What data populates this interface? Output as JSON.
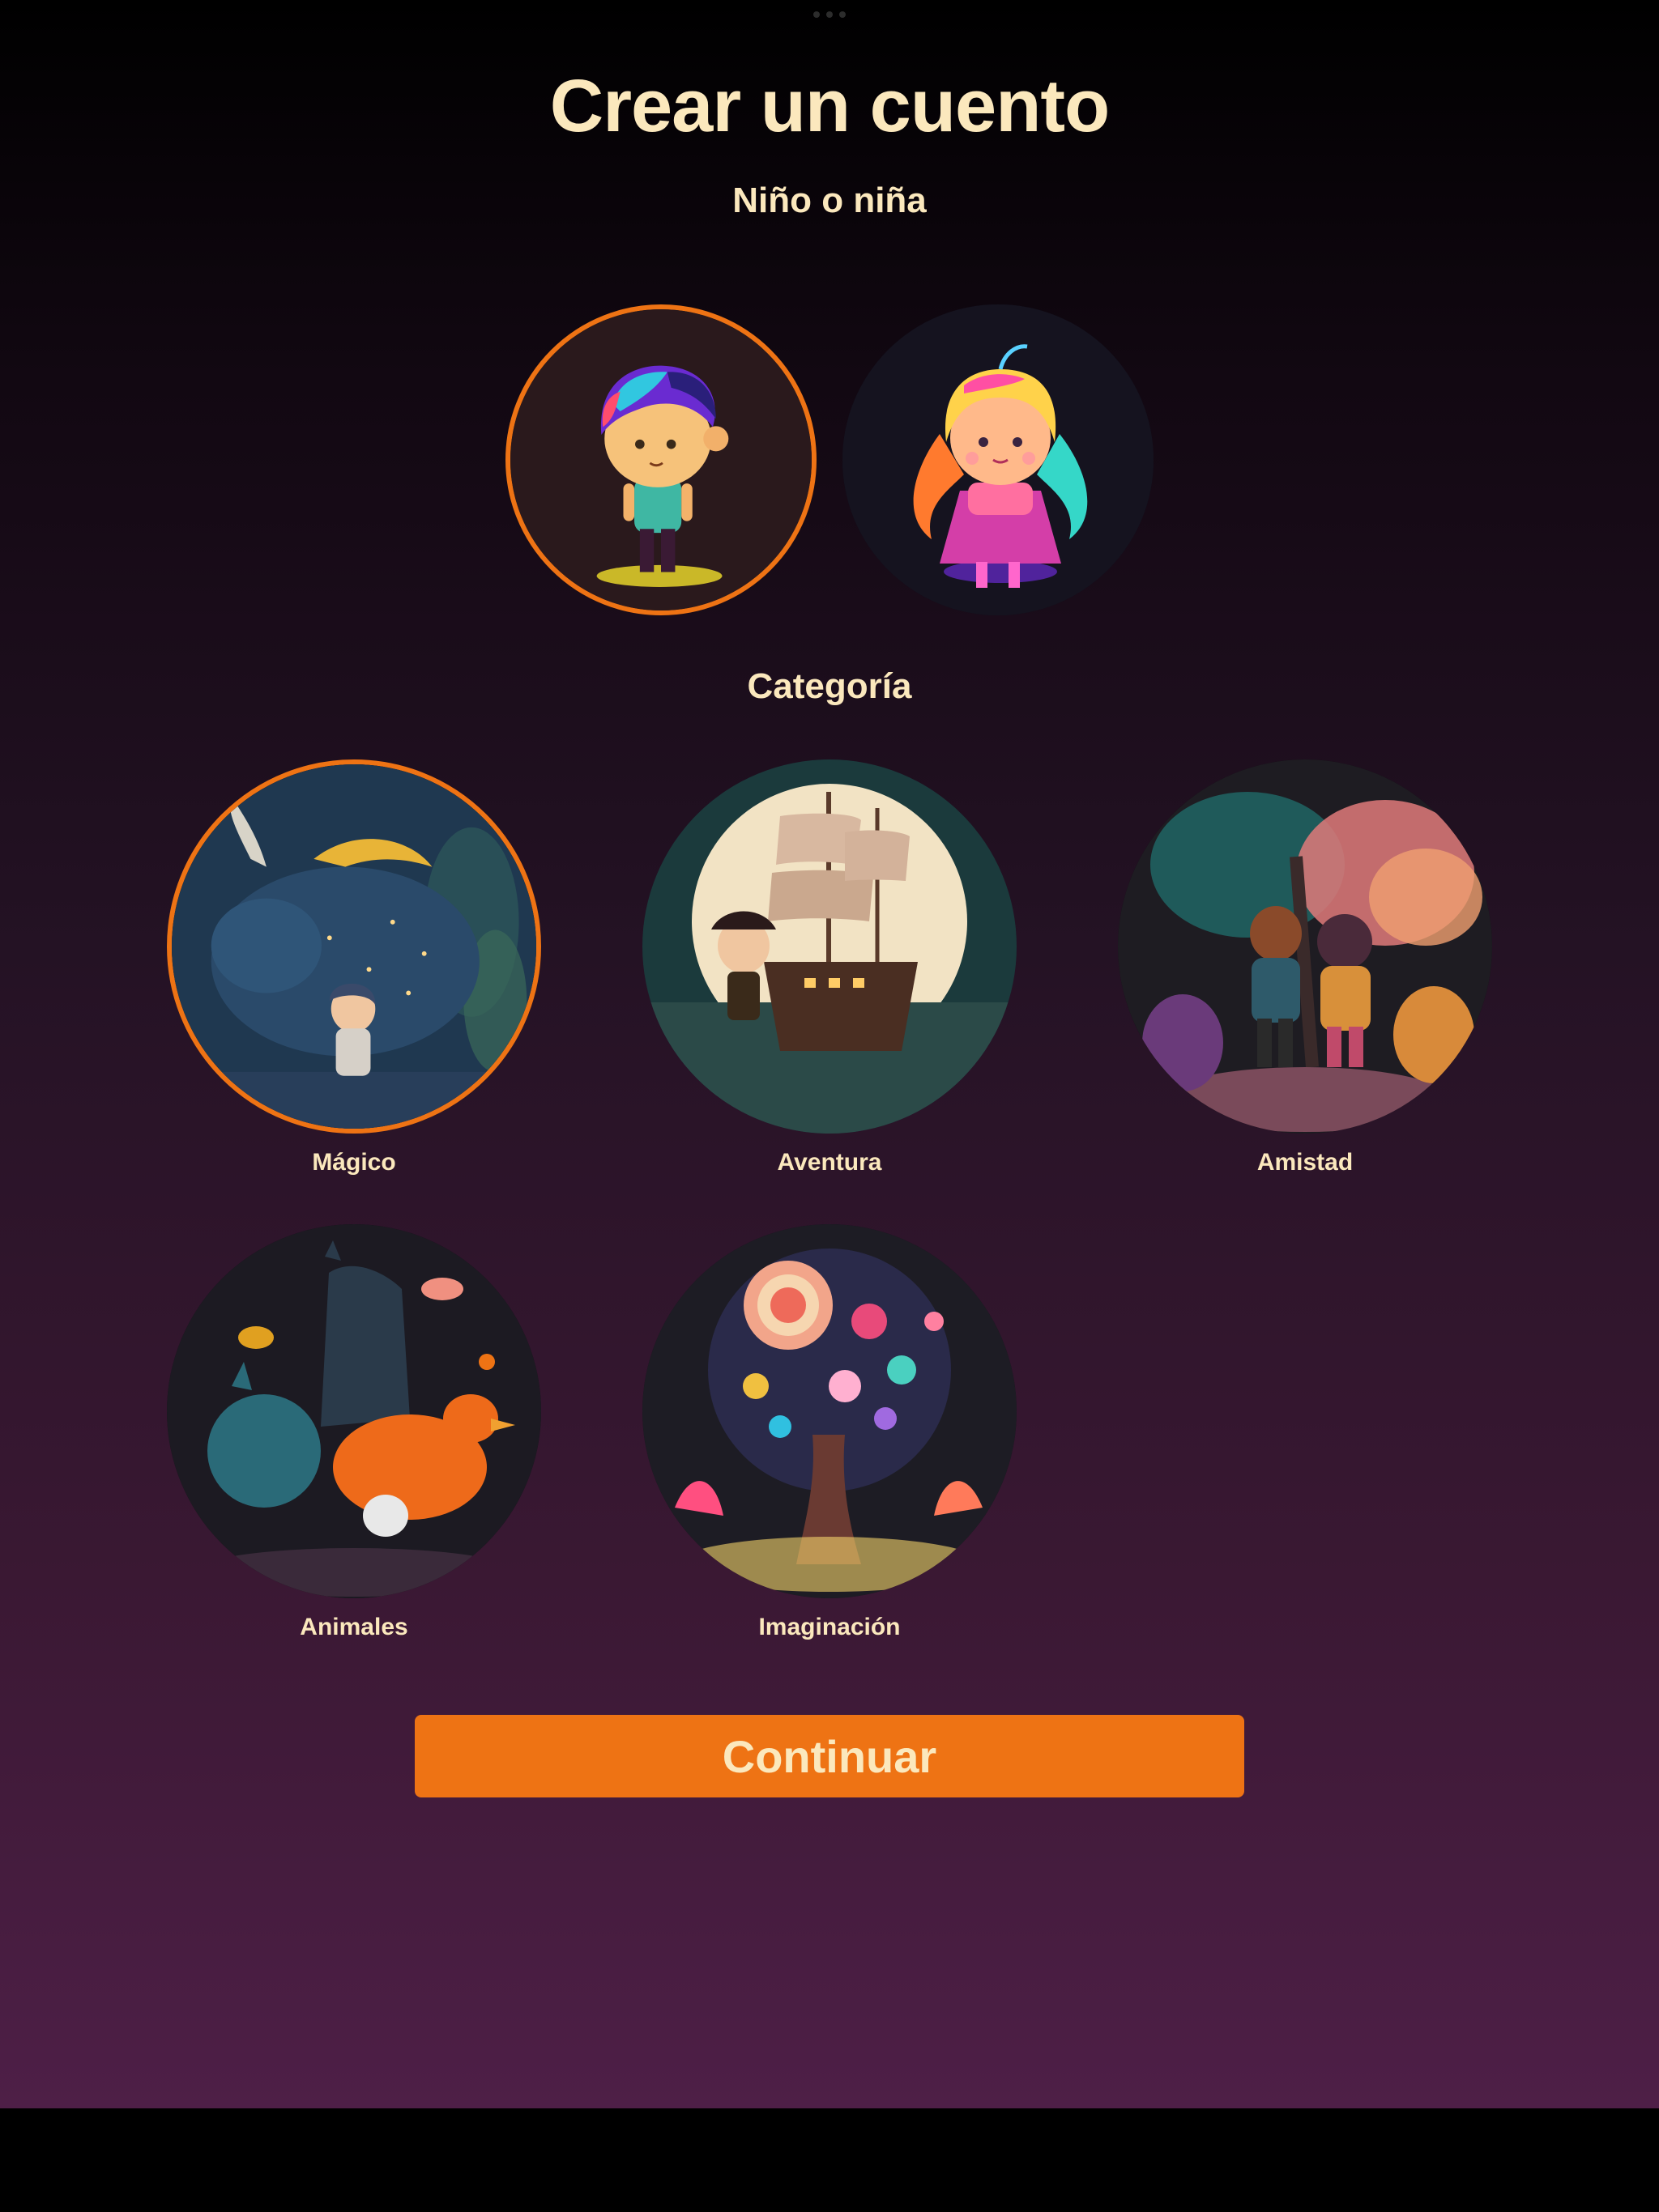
{
  "header": {
    "title": "Crear un cuento"
  },
  "gender": {
    "title": "Niño o niña",
    "options": [
      {
        "icon": "boy-avatar",
        "selected": true
      },
      {
        "icon": "girl-avatar",
        "selected": false
      }
    ]
  },
  "category": {
    "title": "Categoría",
    "items": [
      {
        "label": "Mágico",
        "icon": "magic-creature-image",
        "selected": true
      },
      {
        "label": "Aventura",
        "icon": "pirate-ship-image",
        "selected": false
      },
      {
        "label": "Amistad",
        "icon": "friends-forest-image",
        "selected": false
      },
      {
        "label": "Animales",
        "icon": "animals-image",
        "selected": false
      },
      {
        "label": "Imaginación",
        "icon": "fantasy-tree-image",
        "selected": false
      }
    ]
  },
  "actions": {
    "continue_label": "Continuar"
  },
  "colors": {
    "accent": "#ee7314",
    "text": "#fbe8bd",
    "background_top": "#000000",
    "background_bottom": "#4e1f47"
  }
}
